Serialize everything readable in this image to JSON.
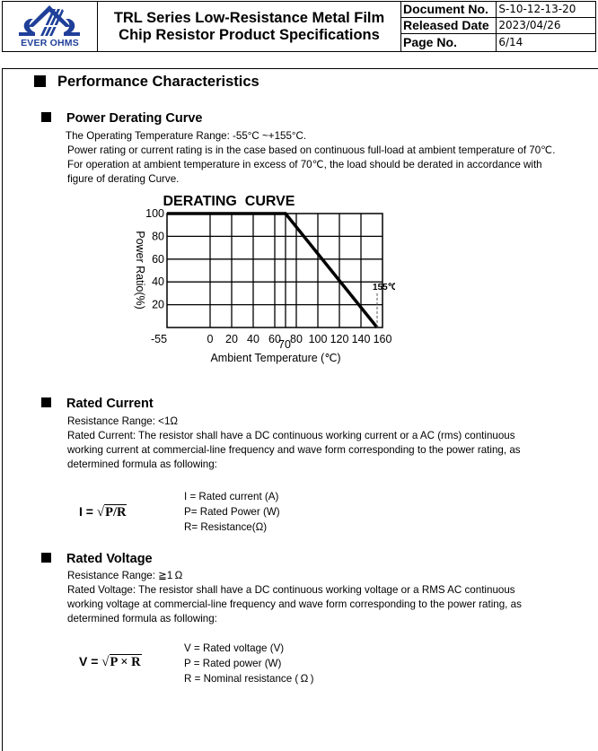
{
  "header": {
    "logo_text": "EVER OHMS",
    "title_line1": "TRL Series Low-Resistance Metal Film",
    "title_line2": "Chip Resistor Product Specifications",
    "meta": [
      {
        "label": "Document No.",
        "value": "S-10-12-13-20"
      },
      {
        "label": "Released Date",
        "value": "2023/04/26"
      },
      {
        "label": "Page No.",
        "value": "6/14"
      }
    ]
  },
  "section_title": "Performance Characteristics",
  "derating": {
    "heading": "Power Derating Curve",
    "lines": [
      "The Operating Temperature Range: -55°C ~+155°C.",
      "Power rating or current rating is in the case based on continuous full-load at ambient temperature of 70℃.",
      "For operation at ambient temperature in excess of 70℃, the load should be derated in accordance with",
      "figure of derating Curve."
    ]
  },
  "chart_data": {
    "type": "line",
    "title": "DERATING  CURVE",
    "xlabel": "Ambient Temperature (℃)",
    "ylabel": "Power Ratio(%)",
    "x_tick_labels": [
      "-55",
      "0",
      "20",
      "40",
      "60",
      "80",
      "100",
      "120",
      "140",
      "160"
    ],
    "x_ticks": [
      -40,
      0,
      20,
      40,
      60,
      80,
      100,
      120,
      140,
      160
    ],
    "x_extra_label": {
      "text": "70",
      "x": 70
    },
    "y_ticks": [
      20,
      40,
      60,
      80,
      100
    ],
    "y_tick_labels": [
      "20",
      "40",
      "60",
      "80",
      "100"
    ],
    "xlim": [
      -40,
      160
    ],
    "ylim": [
      0,
      100
    ],
    "grid": true,
    "series": [
      {
        "name": "Power Ratio",
        "x": [
          -55,
          70,
          155
        ],
        "y": [
          100,
          100,
          0
        ]
      }
    ],
    "annotations": [
      {
        "text": "155℃",
        "x": 155,
        "y": 0,
        "style": "dashed-vertical-marker"
      }
    ]
  },
  "rated_current": {
    "heading": "Rated Current",
    "lines": [
      "Resistance Range: <1Ω",
      "Rated Current: The resistor shall have a DC continuous working current or a AC (rms) continuous",
      "working current at commercial-line frequency and wave form corresponding to the power rating, as",
      "determined formula as following:"
    ],
    "formula_lhs": "I =",
    "formula_body": "P/R",
    "legend": [
      "I = Rated current (A)",
      "P= Rated Power (W)",
      "R= Resistance(Ω)"
    ]
  },
  "rated_voltage": {
    "heading": "Rated Voltage",
    "lines": [
      "Resistance Range: ≧1 Ω",
      "Rated Voltage: The resistor shall have a DC continuous working voltage or a RMS AC continuous",
      "working voltage at commercial-line frequency and wave form corresponding to the power rating, as",
      "determined formula as following:"
    ],
    "formula_lhs": "V =",
    "formula_body": "P × R",
    "legend": [
      "V = Rated voltage (V)",
      "P = Rated power (W)",
      "R = Nominal resistance ( Ω )"
    ]
  }
}
